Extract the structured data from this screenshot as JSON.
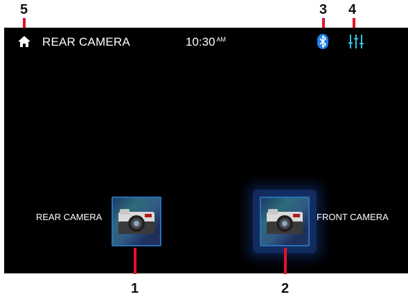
{
  "header": {
    "title": "REAR CAMERA",
    "time": "10:30",
    "ampm": "AM"
  },
  "icons": {
    "home": "home-icon",
    "bluetooth": "bluetooth-icon",
    "settings": "equalizer-settings-icon",
    "camera": "camera-icon"
  },
  "cameras": {
    "rear": {
      "label": "REAR CAMERA"
    },
    "front": {
      "label": "FRONT CAMERA"
    }
  },
  "callouts": {
    "rear_camera": "1",
    "front_camera": "2",
    "bluetooth": "3",
    "settings": "4",
    "home": "5"
  },
  "colors": {
    "screen_bg": "#000000",
    "accent_blue": "#1e7fe6",
    "eq_cyan": "#2cc7e0",
    "callout_red": "#e3122a"
  }
}
